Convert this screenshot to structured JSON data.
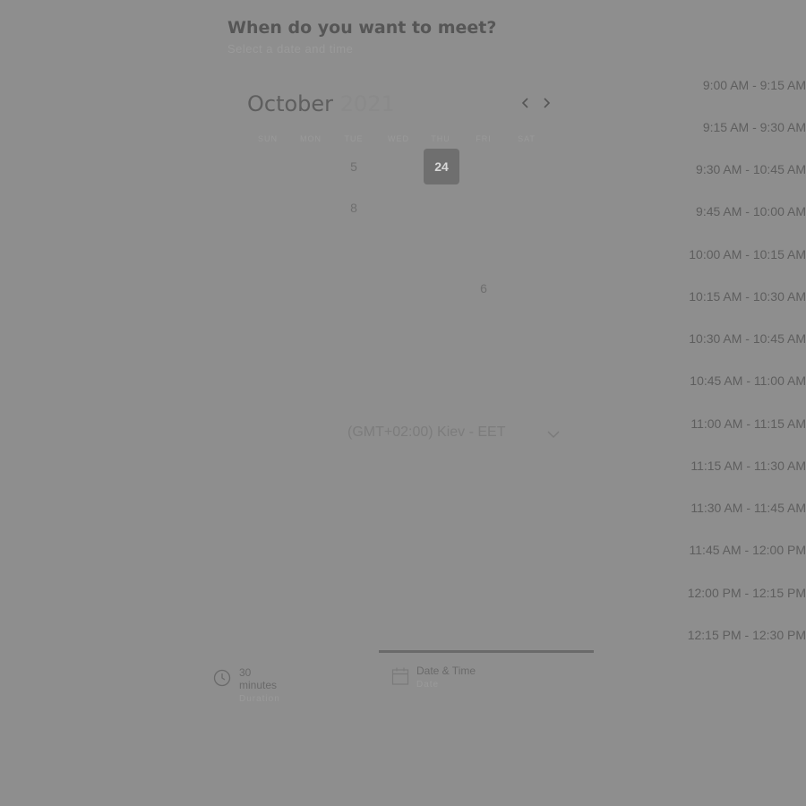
{
  "header": {
    "title": "When do you want to meet?",
    "subtitle": "Select a date and time"
  },
  "calendar": {
    "month": "October",
    "year": "2021",
    "weekdays": [
      "SUN",
      "MON",
      "TUE",
      "WED",
      "THU",
      "FRI",
      "SAT"
    ],
    "days": [
      "5",
      "24",
      "8",
      "6"
    ],
    "selected_day": "24"
  },
  "timezone": {
    "value": "(GMT+02:00) Kiev - EET"
  },
  "slots": [
    "9:00 AM - 9:15 AM",
    "9:15 AM - 9:30 AM",
    "9:30 AM - 10:45 AM",
    "9:45 AM - 10:00 AM",
    "10:00 AM - 10:15 AM",
    "10:15 AM - 10:30 AM",
    "10:30 AM - 10:45 AM",
    "10:45 AM - 11:00 AM",
    "11:00 AM - 11:15 AM",
    "11:15 AM - 11:30 AM",
    "11:30 AM - 11:45 AM",
    "11:45 AM - 12:00 PM",
    "12:00 PM - 12:15 PM",
    "12:15 PM - 12:30 PM"
  ],
  "footer": {
    "duration_label": "30 minutes",
    "duration_sub": "Duration",
    "datetime_label": "Date & Time",
    "datetime_sub": "Date"
  },
  "icons": {
    "prev": "chevron-left-icon",
    "next": "chevron-right-icon",
    "tz": "chevron-down-icon",
    "clock": "clock-icon",
    "calendar": "calendar-icon"
  }
}
